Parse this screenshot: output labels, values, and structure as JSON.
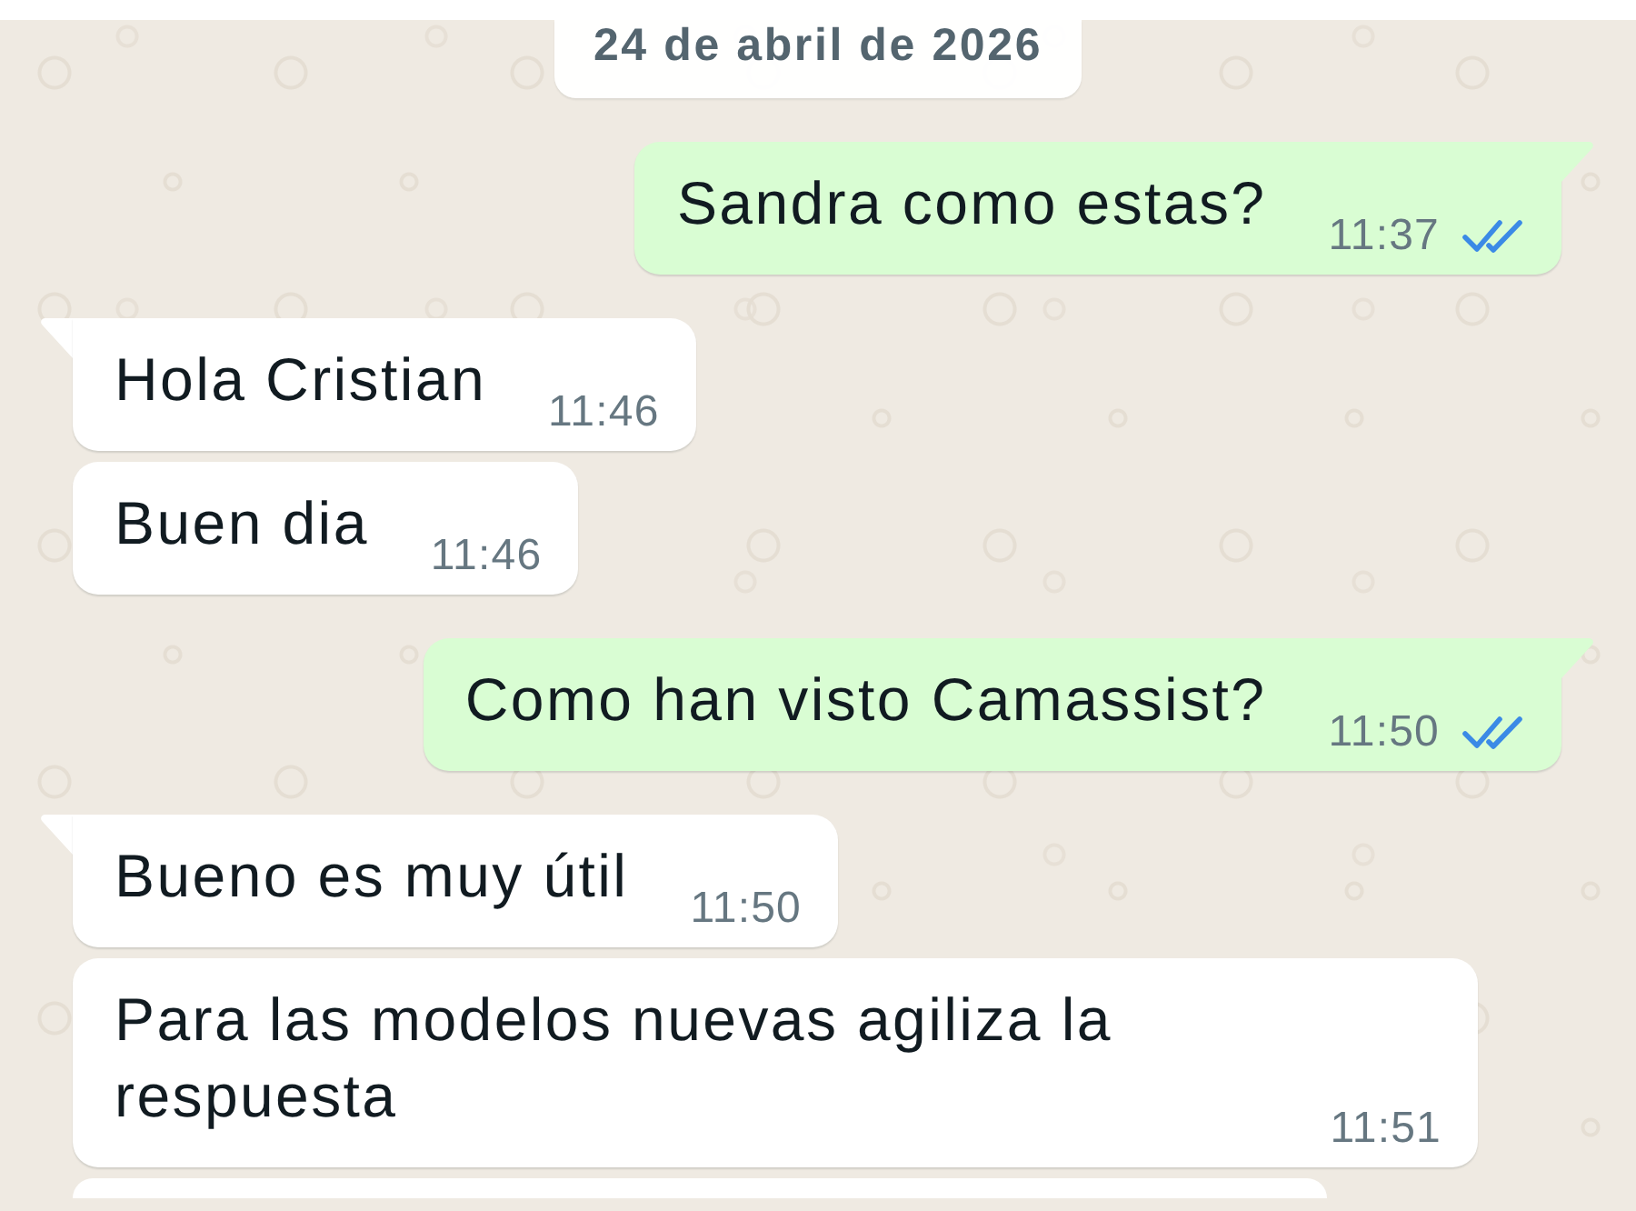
{
  "date_separator": {
    "label": "24 de abril de 2026"
  },
  "messages": [
    {
      "kind": "sent",
      "tail": true,
      "text": "Sandra como estas?",
      "time": "11:37",
      "read": true
    },
    {
      "kind": "received",
      "tail": true,
      "text": "Hola Cristian",
      "time": "11:46"
    },
    {
      "kind": "received",
      "tail": false,
      "text": "Buen dia",
      "time": "11:46"
    },
    {
      "kind": "sent",
      "tail": true,
      "text": "Como han visto Camassist?",
      "time": "11:50",
      "read": true
    },
    {
      "kind": "received",
      "tail": true,
      "text": "Bueno es muy útil",
      "time": "11:50"
    },
    {
      "kind": "received",
      "tail": false,
      "text": "Para las modelos nuevas agiliza la respuesta",
      "time": "11:51"
    },
    {
      "kind": "received",
      "tail": false
    }
  ]
}
